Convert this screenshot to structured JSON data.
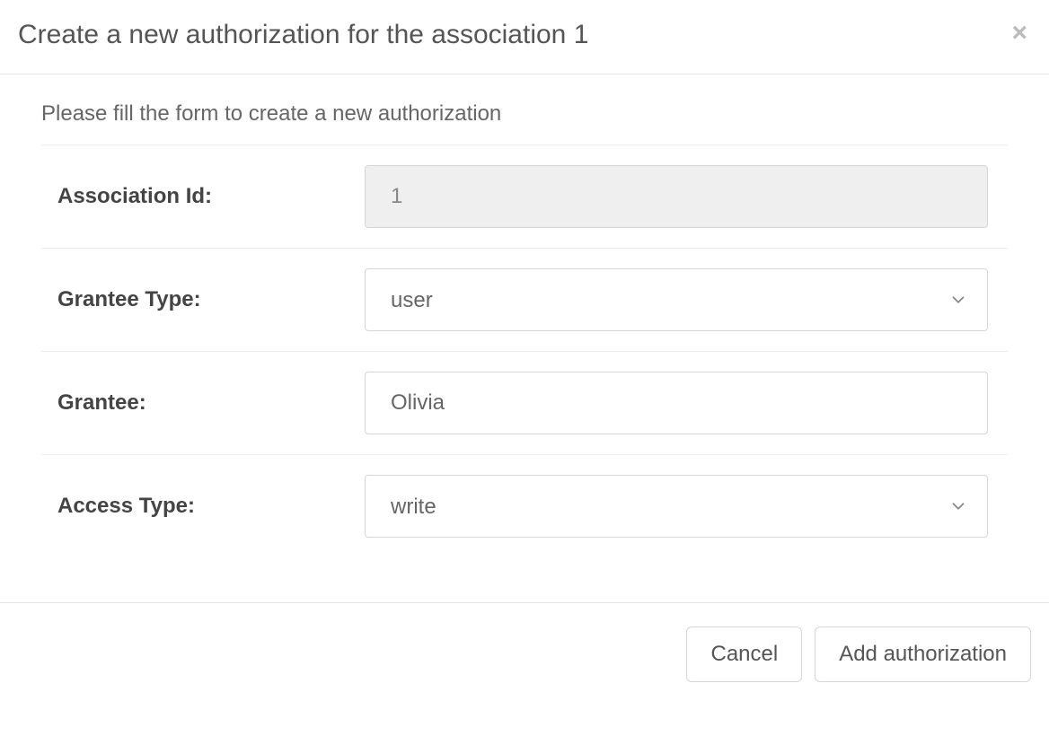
{
  "header": {
    "title": "Create a new authorization for the association 1"
  },
  "body": {
    "instructions": "Please fill the form to create a new authorization",
    "fields": {
      "association_id": {
        "label": "Association Id:",
        "value": "1"
      },
      "grantee_type": {
        "label": "Grantee Type:",
        "value": "user"
      },
      "grantee": {
        "label": "Grantee:",
        "value": "Olivia"
      },
      "access_type": {
        "label": "Access Type:",
        "value": "write"
      }
    }
  },
  "footer": {
    "cancel": "Cancel",
    "submit": "Add authorization"
  }
}
